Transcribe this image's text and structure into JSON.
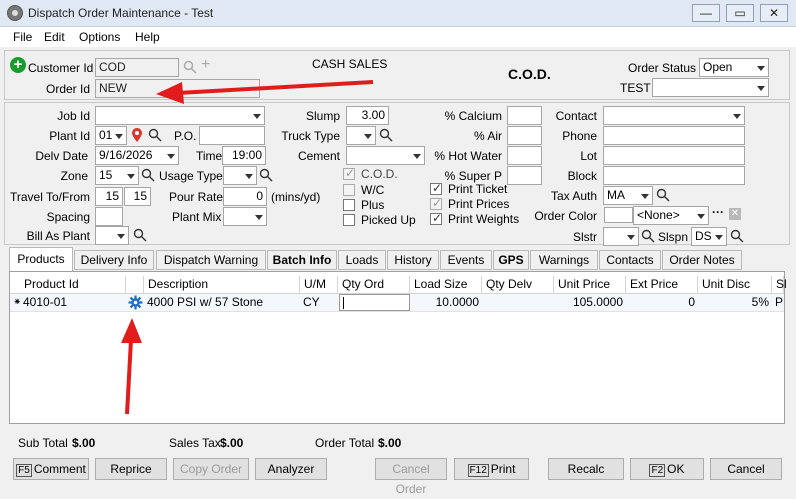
{
  "window": {
    "title": "Dispatch Order Maintenance - Test",
    "min": "—",
    "max": "▭",
    "close": "✕"
  },
  "menu": [
    "File",
    "Edit",
    "Options",
    "Help"
  ],
  "header": {
    "customer_id_label": "Customer Id",
    "customer_id": "COD",
    "order_id_label": "Order Id",
    "order_id": "NEW",
    "customer_name": "CASH SALES",
    "cod_label": "C.O.D.",
    "order_status_label": "Order Status",
    "order_status": "Open",
    "test_label": "TEST",
    "test_value": ""
  },
  "form": {
    "job_id_label": "Job Id",
    "job_id": "",
    "plant_id_label": "Plant Id",
    "plant_id": "01",
    "po_label": "P.O.",
    "po": "",
    "delv_date_label": "Delv Date",
    "delv_date": "9/16/2026",
    "time_label": "Time",
    "time": "19:00",
    "zone_label": "Zone",
    "zone": "15",
    "usage_type_label": "Usage Type",
    "usage_type": "",
    "travel_label": "Travel To/From",
    "travel_to": "15",
    "travel_from": "15",
    "pour_rate_label": "Pour Rate",
    "pour_rate": "0",
    "pour_units": "(mins/yd)",
    "spacing_label": "Spacing",
    "spacing": "",
    "plant_mix_label": "Plant Mix",
    "plant_mix": "",
    "bill_as_plant_label": "Bill As Plant",
    "bill_as_plant": "",
    "slump_label": "Slump",
    "slump": "3.00",
    "truck_type_label": "Truck Type",
    "truck_type": "",
    "cement_label": "Cement",
    "cement": "",
    "cod_check": "C.O.D.",
    "wc_check": "W/C",
    "plus_check": "Plus",
    "picked_up_check": "Picked Up",
    "calcium_label": "% Calcium",
    "calcium": "",
    "air_label": "% Air",
    "air": "",
    "hot_water_label": "% Hot Water",
    "hot_water": "",
    "super_p_label": "% Super P",
    "super_p": "",
    "print_ticket": "Print Ticket",
    "print_prices": "Print Prices",
    "print_weights": "Print Weights",
    "contact_label": "Contact",
    "contact": "",
    "phone_label": "Phone",
    "phone": "",
    "lot_label": "Lot",
    "lot": "",
    "block_label": "Block",
    "block": "",
    "tax_auth_label": "Tax Auth",
    "tax_auth": "MA",
    "order_color_label": "Order Color",
    "order_color": "<None>",
    "slstr_label": "Slstr",
    "slstr": "",
    "slspn_label": "Slspn",
    "slspn": "DS",
    "more": "···"
  },
  "tabs": [
    "Products",
    "Delivery Info",
    "Dispatch Warning",
    "Batch Info",
    "Loads",
    "History",
    "Events",
    "GPS",
    "Warnings",
    "Contacts",
    "Order Notes"
  ],
  "grid": {
    "columns": [
      "Product Id",
      "",
      "Description",
      "U/M",
      "Qty Ord",
      "Load Size",
      "Qty Delv",
      "Unit Price",
      "Ext Price",
      "Unit Disc",
      "Sl"
    ],
    "rows": [
      {
        "marker": "⁕",
        "product_id": "4010-01",
        "description": "4000 PSI w/ 57 Stone",
        "um": "CY",
        "qty_ord": "",
        "load_size": "10.0000",
        "qty_delv": "",
        "unit_price": "105.0000",
        "ext_price": "0",
        "unit_disc": "5%",
        "sl": "P"
      }
    ]
  },
  "totals": {
    "sub_total_label": "Sub Total",
    "sub_total": "$.00",
    "sales_tax_label": "Sales Tax",
    "sales_tax": "$.00",
    "order_total_label": "Order Total",
    "order_total": "$.00"
  },
  "buttons": {
    "comment_key": "F5",
    "comment": "Comment",
    "reprice": "Reprice",
    "copy_order": "Copy Order",
    "analyzer": "Analyzer",
    "cancel_order": "Cancel Order",
    "print_key": "F12",
    "print": "Print",
    "recalc": "Recalc",
    "ok_key": "F2",
    "ok": "OK",
    "cancel": "Cancel"
  },
  "colors": {
    "annotation": "#e21c1c",
    "add_green": "#1a9c2c",
    "gear_blue": "#1f6fc4",
    "pin_red": "#d63a2a"
  }
}
